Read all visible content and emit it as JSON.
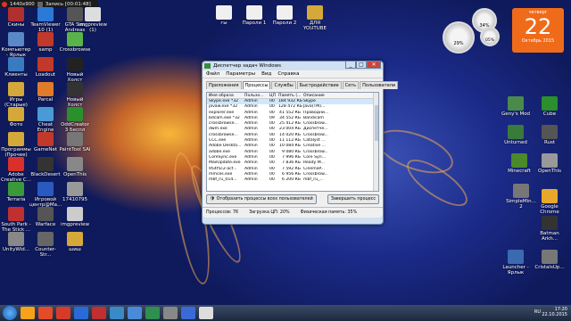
{
  "recorder": {
    "resolution": "1440x900",
    "status": "Запись [00:01:48]"
  },
  "desktop_left": [
    {
      "label": "Скины",
      "color": "#b03030"
    },
    {
      "label": "TeamViewer 10 (1)",
      "color": "#2a7ad8"
    },
    {
      "label": "GTA San Andreas",
      "color": "#555"
    },
    {
      "label": "imgpreview (1)",
      "color": "#ddd"
    },
    {
      "label": "Компьютер - Ярлык",
      "color": "#5a88c8"
    },
    {
      "label": "samp",
      "color": "#c0392b"
    },
    {
      "label": "Crossbrowse",
      "color": "#5ab34a"
    },
    {
      "label": "Клиенты",
      "color": "#3a7ac0"
    },
    {
      "label": "Loadout",
      "color": "#c0392b"
    },
    {
      "label": "Новый Холст",
      "color": "#222"
    },
    {
      "label": "Игры (Старые)",
      "color": "#d4a93a"
    },
    {
      "label": "Parcal",
      "color": "#e07b2a"
    },
    {
      "label": "Новый Холст",
      "color": "#333"
    },
    {
      "label": "Фото",
      "color": "#d4a93a"
    },
    {
      "label": "Cheat Engine",
      "color": "#4a9ad8"
    },
    {
      "label": "OddCreator 3 Беспл",
      "color": "#2b8f2b"
    },
    {
      "label": "Программы (Прочее)",
      "color": "#d4a93a"
    },
    {
      "label": "GameNet",
      "color": "#c0392b"
    },
    {
      "label": "PaintTool SAI",
      "color": "#777"
    },
    {
      "label": "Adobe Creative C...",
      "color": "#d8302a"
    },
    {
      "label": "BlackDesert",
      "color": "#333"
    },
    {
      "label": "OpenThis",
      "color": "#888"
    },
    {
      "label": "Terraria",
      "color": "#3a9a3a"
    },
    {
      "label": "Игровой центр@Ma...",
      "color": "#2a5ac0"
    },
    {
      "label": "17410795",
      "color": "#999"
    },
    {
      "label": "South Park - The Stick ...",
      "color": "#c03030"
    },
    {
      "label": "Warface",
      "color": "#555"
    },
    {
      "label": "imgpreview",
      "color": "#ccc"
    },
    {
      "label": "UnityWid...",
      "color": "#888"
    },
    {
      "label": "Counter-Str...",
      "color": "#666"
    },
    {
      "label": "шиш",
      "color": "#d4a93a"
    }
  ],
  "desktop_top": [
    {
      "label": "гы",
      "color": "#f0f0f0"
    },
    {
      "label": "Пароли 1",
      "color": "#f0f0f0"
    },
    {
      "label": "Пароли 2",
      "color": "#f0f0f0"
    },
    {
      "label": "ДЛЯ YOUTUBE",
      "color": "#d4a93a"
    }
  ],
  "desktop_right": [
    {
      "label": "Geny's Mod",
      "color": "#4a8a4a"
    },
    {
      "label": "Cube",
      "color": "#2b8f2b"
    },
    {
      "label": "Unturned",
      "color": "#3a7a3a"
    },
    {
      "label": "Rust",
      "color": "#555"
    },
    {
      "label": "Minecraft",
      "color": "#4a8a2a"
    },
    {
      "label": "OpenThis",
      "color": "#999"
    },
    {
      "label": "SimpleMin... 2",
      "color": "#777"
    },
    {
      "label": "Google Chrome",
      "color": "#e8a82a"
    },
    {
      "label": "Batman Arkh...",
      "color": "#333"
    },
    {
      "label": "Launcher - Ярлык",
      "color": "#3a6ab0"
    },
    {
      "label": "CristalsUp...",
      "color": "#777"
    }
  ],
  "gadgets": {
    "cpu": "29%",
    "ram": "34%",
    "disk": "05%"
  },
  "calendar": {
    "weekday": "четверг",
    "day": "22",
    "month_year": "Октябрь 2015"
  },
  "taskmgr": {
    "title": "Диспетчер задач Windows",
    "menu": [
      "Файл",
      "Параметры",
      "Вид",
      "Справка"
    ],
    "tabs": [
      "Приложения",
      "Процессы",
      "Службы",
      "Быстродействие",
      "Сеть",
      "Пользователи"
    ],
    "active_tab": 1,
    "columns": [
      "Имя образа",
      "Пользо...",
      "ЦП",
      "Память (...",
      "Описание"
    ],
    "rows": [
      [
        "Skype.exe *32",
        "Admin",
        "00",
        "184 932 КБ",
        "Skype"
      ],
      [
        "javaw.exe *32",
        "Admin",
        "00",
        "128 472 КБ",
        "Java(TM)..."
      ],
      [
        "explorer.exe",
        "Admin",
        "00",
        "41 552 КБ",
        "Проводни..."
      ],
      [
        "bdcam.exe *32",
        "Admin",
        "09",
        "34 552 КБ",
        "Bandicam"
      ],
      [
        "crossbrowse...",
        "Admin",
        "00",
        "25 412 КБ",
        "Crossbrow..."
      ],
      [
        "dwm.exe",
        "Admin",
        "00",
        "23 004 КБ",
        "Диспетче..."
      ],
      [
        "crossbrowse...",
        "Admin",
        "00",
        "14 020 КБ",
        "Crossbrow..."
      ],
      [
        "CCC.exe",
        "Admin",
        "00",
        "11 112 КБ",
        "Catalyst ..."
      ],
      [
        "Adobe Deskto...",
        "Admin",
        "00",
        "10 084 КБ",
        "Creative ..."
      ],
      [
        "adobe.exe",
        "Admin",
        "00",
        "9 080 КБ",
        "Crossbrow..."
      ],
      [
        "CoreSync.exe",
        "Admin",
        "00",
        "7 996 КБ",
        "Core Syn..."
      ],
      [
        "MailUpdate.exe",
        "Admin",
        "00",
        "7 836 КБ",
        "Ready M..."
      ],
      [
        "954f5c2-acf...",
        "Admin",
        "00",
        "7 592 КБ",
        "CinemaP..."
      ],
      [
        "mmces.exe",
        "Admin",
        "00",
        "6 956 КБ",
        "Crossbrow..."
      ],
      [
        "mbf_ru_014...",
        "Admin",
        "00",
        "6 200 КБ",
        "mbf_ru_..."
      ]
    ],
    "show_all": "Отобразить процессы всех пользователей",
    "end_process": "Завершить процесс",
    "status": [
      "Процессов: 76",
      "Загрузка ЦП: 20%",
      "Физическая память: 35%"
    ]
  },
  "taskbar": {
    "apps": [
      "#f7a21a",
      "#e34b2a",
      "#d83a2a",
      "#2a6ad8",
      "#c03030",
      "#3a8ac8",
      "#4a8ad8",
      "#2f8f4f",
      "#888",
      "#3a6ad8",
      "#ddd"
    ],
    "time": "17:20",
    "date": "22.10.2015",
    "lang": "RU"
  }
}
